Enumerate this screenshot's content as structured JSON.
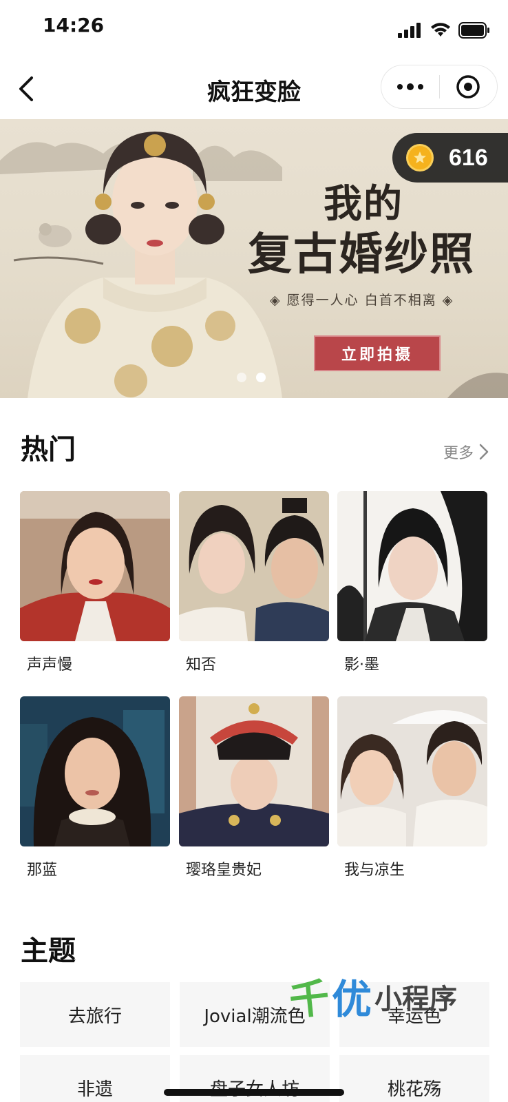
{
  "status_bar": {
    "time": "14:26"
  },
  "nav": {
    "title": "疯狂变脸"
  },
  "banner": {
    "title_line1": "我的",
    "title_line2": "复古婚纱照",
    "subtitle": "◈ 愿得一人心 白首不相离 ◈",
    "cta": "立即拍摄",
    "slide_count": 2,
    "active_slide": 2
  },
  "coins": {
    "value": "616"
  },
  "hot": {
    "title": "热门",
    "more": "更多",
    "items": [
      {
        "label": "声声慢"
      },
      {
        "label": "知否"
      },
      {
        "label": "影·墨"
      },
      {
        "label": "那蓝"
      },
      {
        "label": "璎珞皇贵妃"
      },
      {
        "label": "我与凉生"
      }
    ]
  },
  "themes": {
    "title": "主题",
    "items": [
      {
        "label": "去旅行"
      },
      {
        "label": "Jovial潮流色"
      },
      {
        "label": "幸运色"
      },
      {
        "label": "非遗"
      },
      {
        "label": "盘子女人坊"
      },
      {
        "label": "桃花殇"
      }
    ]
  },
  "watermark": {
    "part1": "千",
    "part2": "优",
    "part3": "小程序"
  },
  "colors": {
    "cta": "#b9464a",
    "coin": "#f5b21d",
    "badge_bg": "#141414"
  }
}
